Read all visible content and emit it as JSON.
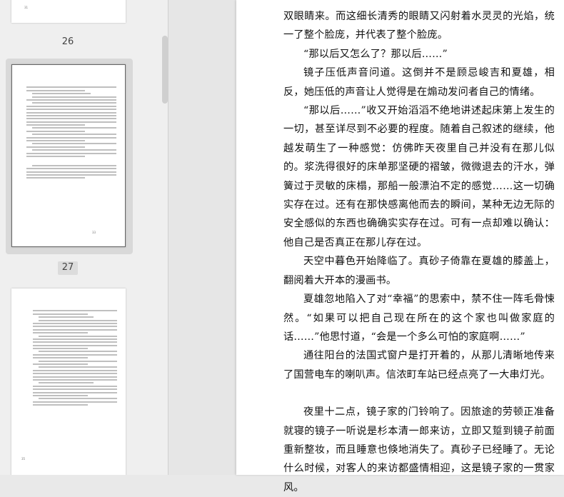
{
  "thumbnails": {
    "label_26": "26",
    "label_27": "27",
    "page_top_num": "31",
    "page_26_num": "33",
    "page_27_num": "35"
  },
  "main": {
    "paragraphs": [
      {
        "indent": false,
        "text": "双眼睛来。而这细长清秀的眼睛又闪射着水灵灵的光焰，统一了整个脸庞，并代表了整个脸庞。"
      },
      {
        "indent": true,
        "text": "“那以后又怎么了？那以后……”"
      },
      {
        "indent": true,
        "text": "镜子压低声音问道。这倒并不是顾忌峻吉和夏雄，相反，她压低的声音让人觉得是在煽动发问者自己的情绪。"
      },
      {
        "indent": true,
        "text": "“那以后……”收又开始滔滔不绝地讲述起床第上发生的一切，甚至详尽到不必要的程度。随着自己叙述的继续，他越发萌生了一种感觉：仿佛昨天夜里自己并没有在那儿似的。浆洗得很好的床单那坚硬的褶皱，微微退去的汗水，弹簧过于灵敏的床榻，那船一般漂泊不定的感觉……这一切确实存在过。还有在那快感离他而去的瞬间，某种无边无际的安全感似的东西也确确实实存在过。可有一点却难以确认：他自己是否真正在那儿存在过。"
      },
      {
        "indent": true,
        "text": "天空中暮色开始降临了。真砂子倚靠在夏雄的膝盖上，翻阅着大开本的漫画书。"
      },
      {
        "indent": true,
        "text": "夏雄忽地陷入了对“幸福”的思索中，禁不住一阵毛骨悚然。“如果可以把自己现在所在的这个家也叫做家庭的话……”他思忖道，“会是一个多么可怕的家庭啊……”"
      },
      {
        "indent": true,
        "text": "通往阳台的法国式窗户是打开着的，从那儿清晰地传来了国营电车的喇叭声。信浓町车站已经点亮了一大串灯光。"
      },
      {
        "indent": true,
        "text": "夜里十二点，镜子家的门铃响了。因旅途的劳顿正准备就寝的镜子一听说是杉本清一郎来访，立即又踅到镜子前面重新整妆，而且睡意也倏地消失了。真砂子已经睡了。无论什么时候，对客人的来访都盛情相迎，这是镜子家的一贯家风。"
      }
    ]
  }
}
